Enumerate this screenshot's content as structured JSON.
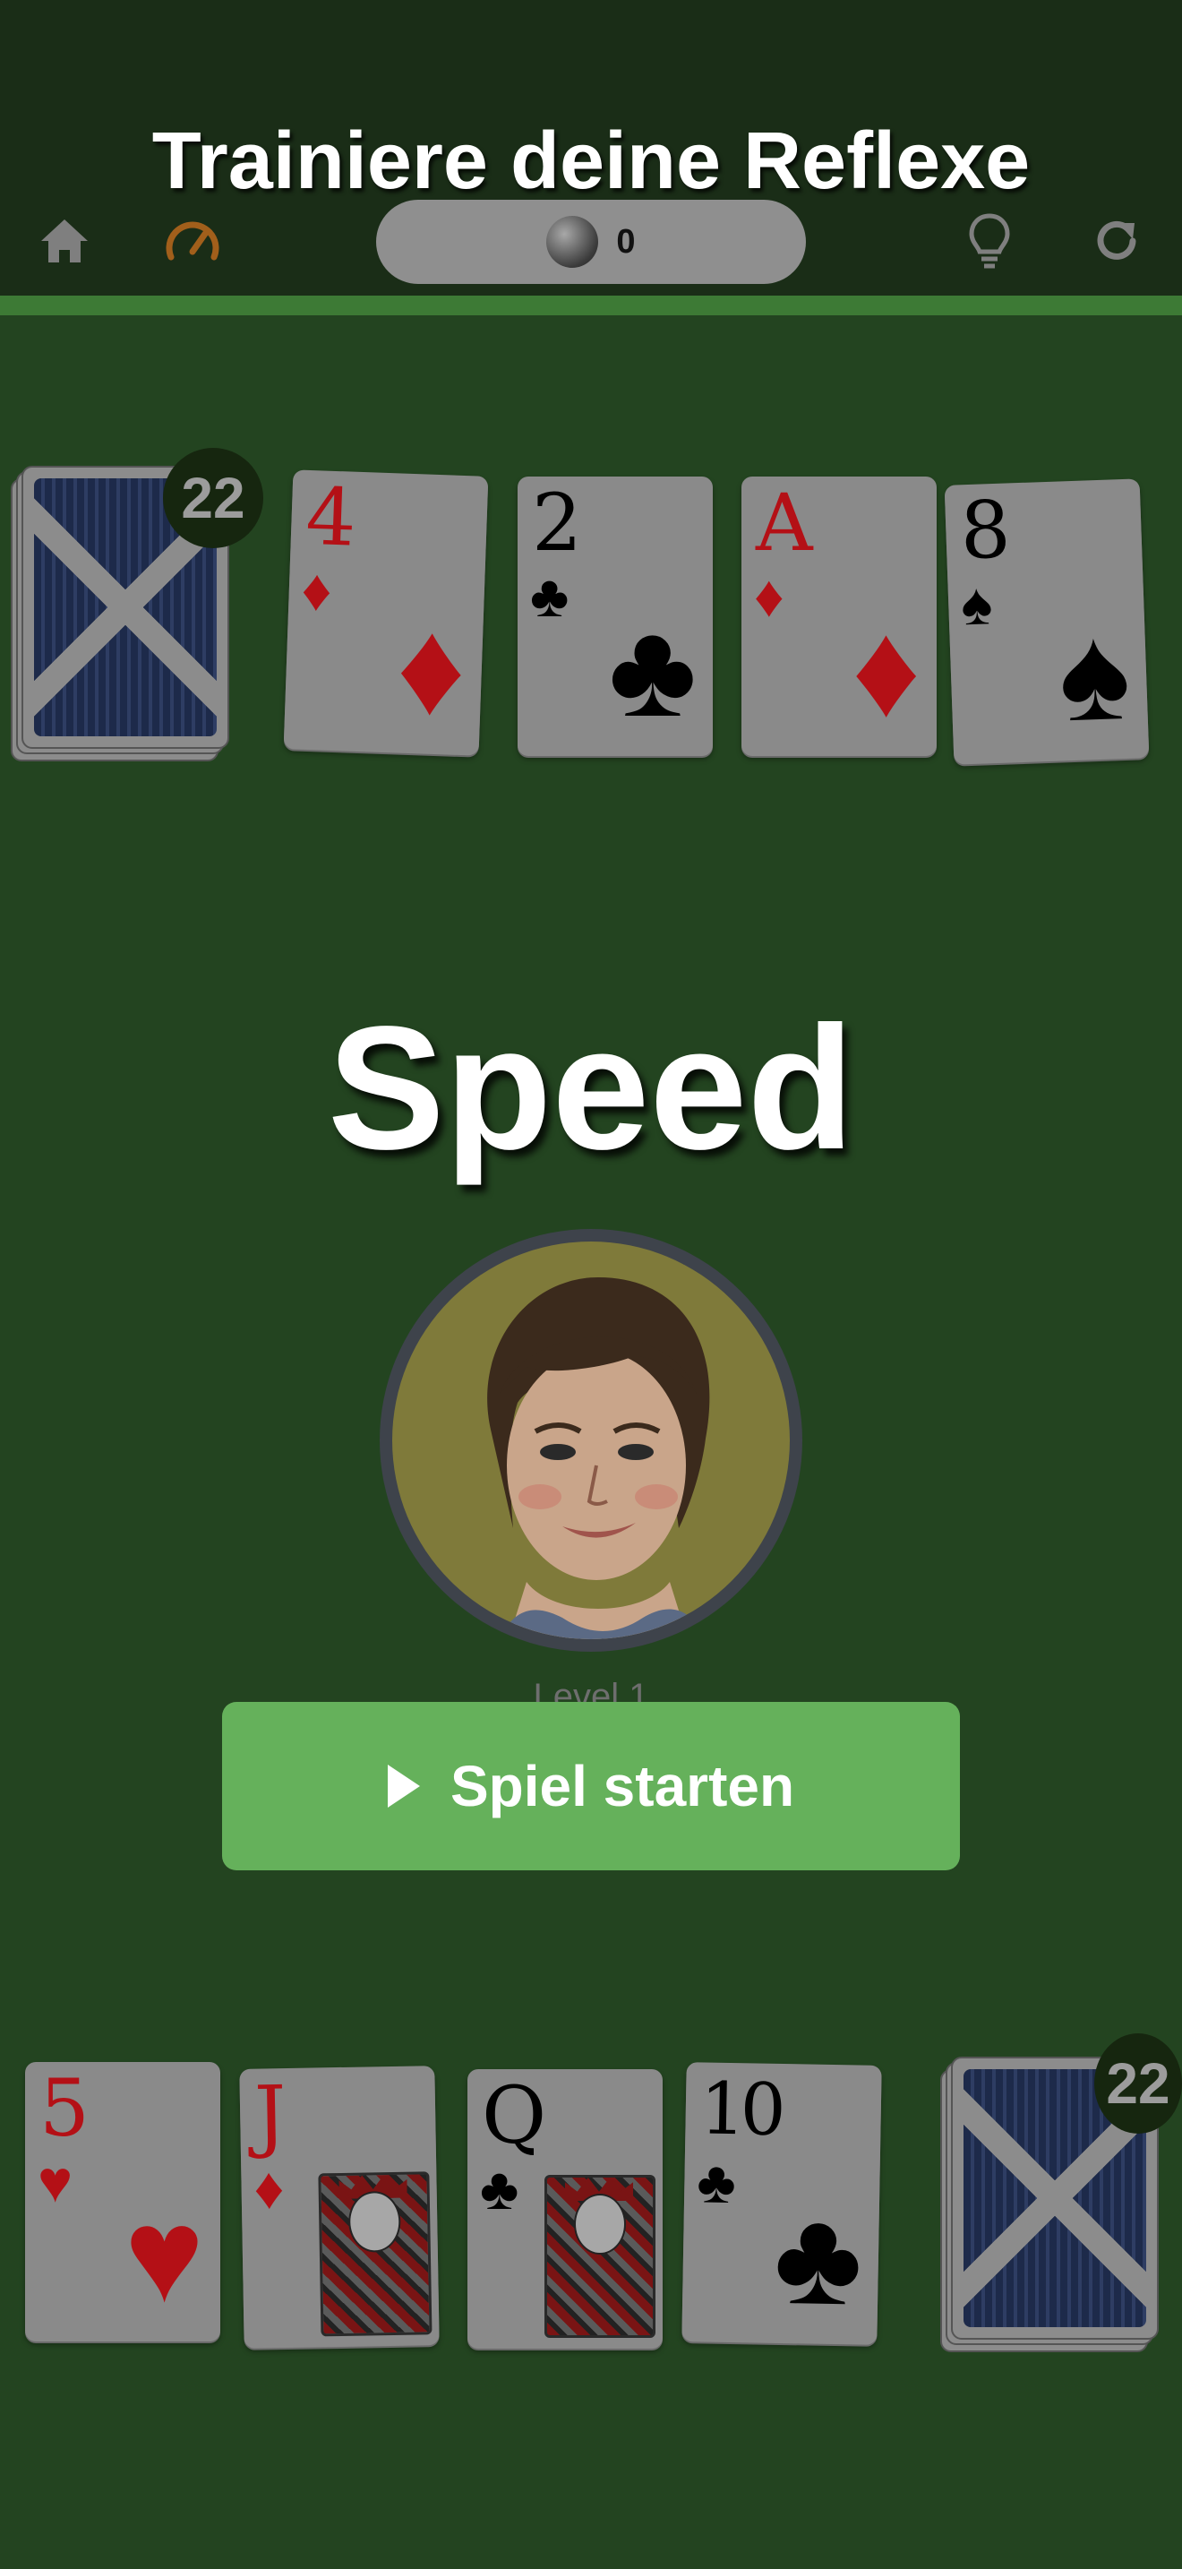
{
  "banner": {
    "text": "Trainiere deine Reflexe"
  },
  "toolbar": {
    "home_icon": "home-icon",
    "speed_icon": "speedometer-icon",
    "hint_icon": "lightbulb-icon",
    "restart_icon": "restart-icon",
    "coins": "0"
  },
  "opponent": {
    "deck_count": "22",
    "cards": [
      {
        "rank": "4",
        "suit": "♦",
        "color": "red"
      },
      {
        "rank": "2",
        "suit": "♣",
        "color": "black"
      },
      {
        "rank": "A",
        "suit": "♦",
        "color": "red"
      },
      {
        "rank": "8",
        "suit": "♠",
        "color": "black"
      }
    ]
  },
  "game": {
    "title": "Speed",
    "level": "Level 1",
    "start_label": "Spiel starten"
  },
  "player": {
    "deck_count": "22",
    "cards": [
      {
        "rank": "5",
        "suit": "♥",
        "color": "red"
      },
      {
        "rank": "J",
        "suit": "♦",
        "color": "red"
      },
      {
        "rank": "Q",
        "suit": "♣",
        "color": "black"
      },
      {
        "rank": "10",
        "suit": "♣",
        "color": "black"
      }
    ]
  },
  "colors": {
    "felt": "#234420",
    "topbar": "#1a2d17",
    "button": "#65b15b",
    "red_suit": "#b41016"
  }
}
